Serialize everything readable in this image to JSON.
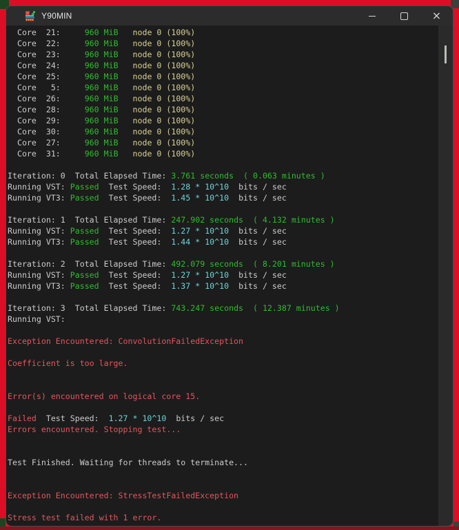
{
  "colors": {
    "fg": "#cccccc",
    "green": "#2ebd2e",
    "yellow": "#d8d096",
    "cyan": "#6fd4d8",
    "red": "#e5555e",
    "term_bg": "#1c1c1c",
    "titlebar_bg": "#2c2c2c",
    "border_red": "#dc0e26",
    "strip": "#801620",
    "scroll_track": "#2a2a2a",
    "scroll_thumb": "#b7beb7",
    "control_fg": "#d6d6d6",
    "title_fg": "#e4e4e4",
    "window_border": "#4b4b4b",
    "corner_green": "#1c4420",
    "corner_gray": "#3a413b"
  },
  "window": {
    "title": "Y90MIN",
    "controls": {
      "minimize": "minimize",
      "maximize": "maximize",
      "close": "×"
    }
  },
  "terminal": {
    "lines": [
      [
        {
          "t": "  Core  21:     ",
          "c": "fg"
        },
        {
          "t": "960 MiB",
          "c": "green"
        },
        {
          "t": "   node 0 (100%)",
          "c": "yellow"
        }
      ],
      [
        {
          "t": "  Core  22:     ",
          "c": "fg"
        },
        {
          "t": "960 MiB",
          "c": "green"
        },
        {
          "t": "   node 0 (100%)",
          "c": "yellow"
        }
      ],
      [
        {
          "t": "  Core  23:     ",
          "c": "fg"
        },
        {
          "t": "960 MiB",
          "c": "green"
        },
        {
          "t": "   node 0 (100%)",
          "c": "yellow"
        }
      ],
      [
        {
          "t": "  Core  24:     ",
          "c": "fg"
        },
        {
          "t": "960 MiB",
          "c": "green"
        },
        {
          "t": "   node 0 (100%)",
          "c": "yellow"
        }
      ],
      [
        {
          "t": "  Core  25:     ",
          "c": "fg"
        },
        {
          "t": "960 MiB",
          "c": "green"
        },
        {
          "t": "   node 0 (100%)",
          "c": "yellow"
        }
      ],
      [
        {
          "t": "  Core   5:     ",
          "c": "fg"
        },
        {
          "t": "960 MiB",
          "c": "green"
        },
        {
          "t": "   node 0 (100%)",
          "c": "yellow"
        }
      ],
      [
        {
          "t": "  Core  26:     ",
          "c": "fg"
        },
        {
          "t": "960 MiB",
          "c": "green"
        },
        {
          "t": "   node 0 (100%)",
          "c": "yellow"
        }
      ],
      [
        {
          "t": "  Core  28:     ",
          "c": "fg"
        },
        {
          "t": "960 MiB",
          "c": "green"
        },
        {
          "t": "   node 0 (100%)",
          "c": "yellow"
        }
      ],
      [
        {
          "t": "  Core  29:     ",
          "c": "fg"
        },
        {
          "t": "960 MiB",
          "c": "green"
        },
        {
          "t": "   node 0 (100%)",
          "c": "yellow"
        }
      ],
      [
        {
          "t": "  Core  30:     ",
          "c": "fg"
        },
        {
          "t": "960 MiB",
          "c": "green"
        },
        {
          "t": "   node 0 (100%)",
          "c": "yellow"
        }
      ],
      [
        {
          "t": "  Core  27:     ",
          "c": "fg"
        },
        {
          "t": "960 MiB",
          "c": "green"
        },
        {
          "t": "   node 0 (100%)",
          "c": "yellow"
        }
      ],
      [
        {
          "t": "  Core  31:     ",
          "c": "fg"
        },
        {
          "t": "960 MiB",
          "c": "green"
        },
        {
          "t": "   node 0 (100%)",
          "c": "yellow"
        }
      ],
      [],
      [
        {
          "t": "Iteration: 0  Total Elapsed Time: ",
          "c": "fg"
        },
        {
          "t": "3.761 seconds  ( 0.063 minutes )",
          "c": "green"
        }
      ],
      [
        {
          "t": "Running VST: ",
          "c": "fg"
        },
        {
          "t": "Passed",
          "c": "green"
        },
        {
          "t": "  Test Speed:  ",
          "c": "fg"
        },
        {
          "t": "1.28 * 10^10",
          "c": "cyan"
        },
        {
          "t": "  bits / sec",
          "c": "fg"
        }
      ],
      [
        {
          "t": "Running VT3: ",
          "c": "fg"
        },
        {
          "t": "Passed",
          "c": "green"
        },
        {
          "t": "  Test Speed:  ",
          "c": "fg"
        },
        {
          "t": "1.45 * 10^10",
          "c": "cyan"
        },
        {
          "t": "  bits / sec",
          "c": "fg"
        }
      ],
      [],
      [
        {
          "t": "Iteration: 1  Total Elapsed Time: ",
          "c": "fg"
        },
        {
          "t": "247.902 seconds  ( 4.132 minutes )",
          "c": "green"
        }
      ],
      [
        {
          "t": "Running VST: ",
          "c": "fg"
        },
        {
          "t": "Passed",
          "c": "green"
        },
        {
          "t": "  Test Speed:  ",
          "c": "fg"
        },
        {
          "t": "1.27 * 10^10",
          "c": "cyan"
        },
        {
          "t": "  bits / sec",
          "c": "fg"
        }
      ],
      [
        {
          "t": "Running VT3: ",
          "c": "fg"
        },
        {
          "t": "Passed",
          "c": "green"
        },
        {
          "t": "  Test Speed:  ",
          "c": "fg"
        },
        {
          "t": "1.44 * 10^10",
          "c": "cyan"
        },
        {
          "t": "  bits / sec",
          "c": "fg"
        }
      ],
      [],
      [
        {
          "t": "Iteration: 2  Total Elapsed Time: ",
          "c": "fg"
        },
        {
          "t": "492.079 seconds  ( 8.201 minutes )",
          "c": "green"
        }
      ],
      [
        {
          "t": "Running VST: ",
          "c": "fg"
        },
        {
          "t": "Passed",
          "c": "green"
        },
        {
          "t": "  Test Speed:  ",
          "c": "fg"
        },
        {
          "t": "1.27 * 10^10",
          "c": "cyan"
        },
        {
          "t": "  bits / sec",
          "c": "fg"
        }
      ],
      [
        {
          "t": "Running VT3: ",
          "c": "fg"
        },
        {
          "t": "Passed",
          "c": "green"
        },
        {
          "t": "  Test Speed:  ",
          "c": "fg"
        },
        {
          "t": "1.37 * 10^10",
          "c": "cyan"
        },
        {
          "t": "  bits / sec",
          "c": "fg"
        }
      ],
      [],
      [
        {
          "t": "Iteration: 3  Total Elapsed Time: ",
          "c": "fg"
        },
        {
          "t": "743.247 seconds  ( 12.387 minutes )",
          "c": "green"
        }
      ],
      [
        {
          "t": "Running VST:",
          "c": "fg"
        }
      ],
      [],
      [
        {
          "t": "Exception Encountered: ConvolutionFailedException",
          "c": "red"
        }
      ],
      [],
      [
        {
          "t": "Coefficient is too large.",
          "c": "red"
        }
      ],
      [],
      [],
      [
        {
          "t": "Error(s) encountered on logical core 15.",
          "c": "red"
        }
      ],
      [],
      [
        {
          "t": "Failed",
          "c": "red"
        },
        {
          "t": "  Test Speed:  ",
          "c": "fg"
        },
        {
          "t": "1.27 * 10^10",
          "c": "cyan"
        },
        {
          "t": "  bits / sec",
          "c": "fg"
        }
      ],
      [
        {
          "t": "Errors encountered. Stopping test...",
          "c": "red"
        }
      ],
      [],
      [],
      [
        {
          "t": "Test Finished. Waiting for threads to terminate...",
          "c": "fg"
        }
      ],
      [],
      [],
      [
        {
          "t": "Exception Encountered: StressTestFailedException",
          "c": "red"
        }
      ],
      [],
      [
        {
          "t": "Stress test failed with 1 error.",
          "c": "red"
        }
      ]
    ]
  }
}
